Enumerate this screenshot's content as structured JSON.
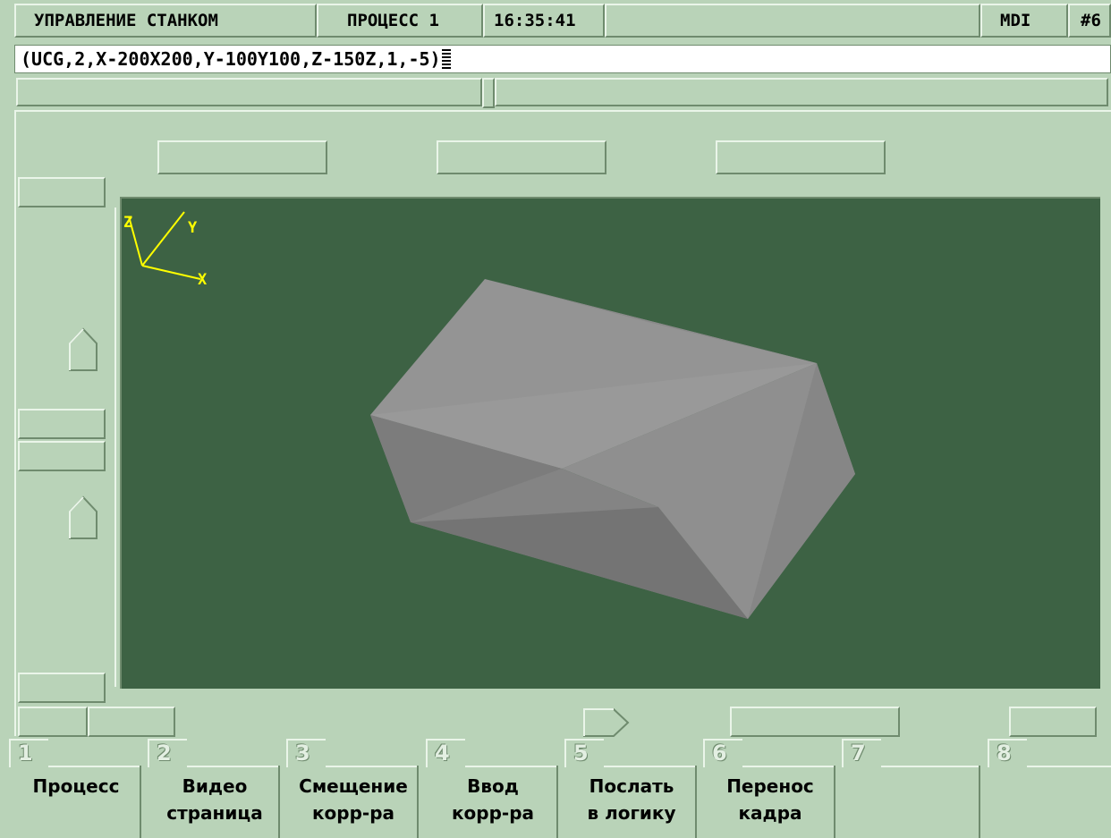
{
  "header": {
    "title": "УПРАВЛЕНИЕ СТАНКОМ",
    "process": "ПРОЦЕСС 1",
    "time": "16:35:41",
    "mode": "MDI",
    "channel": "#6"
  },
  "command_line": {
    "value": "(UCG,2,X-200X200,Y-100Y100,Z-150Z,1,-5)"
  },
  "viewport": {
    "background": "#3d6244",
    "axes": {
      "x": "X",
      "y": "Y",
      "z": "Z",
      "color": "#ffff00"
    },
    "solid_color": "#8e8e8e"
  },
  "softkeys": [
    {
      "num": "1",
      "line1": "Процесс",
      "line2": ""
    },
    {
      "num": "2",
      "line1": "Видео",
      "line2": "страница"
    },
    {
      "num": "3",
      "line1": "Смещение",
      "line2": "корр-ра"
    },
    {
      "num": "4",
      "line1": "Ввод",
      "line2": "корр-ра"
    },
    {
      "num": "5",
      "line1": "Послать",
      "line2": "в логику"
    },
    {
      "num": "6",
      "line1": "Перенос",
      "line2": "кадра"
    },
    {
      "num": "7",
      "line1": "",
      "line2": ""
    },
    {
      "num": "8",
      "line1": "",
      "line2": ""
    }
  ],
  "colors": {
    "panel": "#b9d3b8",
    "highlight": "#eaf5e9",
    "shadow": "#6f8b6e"
  }
}
